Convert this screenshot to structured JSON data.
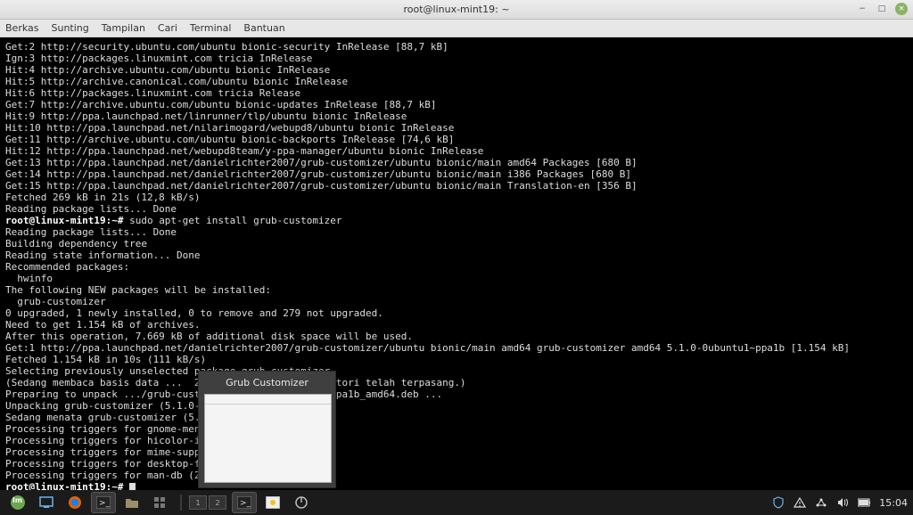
{
  "window": {
    "title": "root@linux-mint19: ~"
  },
  "menubar": {
    "items": [
      "Berkas",
      "Sunting",
      "Tampilan",
      "Cari",
      "Terminal",
      "Bantuan"
    ]
  },
  "terminal": {
    "lines": [
      "Get:2 http://security.ubuntu.com/ubuntu bionic-security InRelease [88,7 kB]",
      "Ign:3 http://packages.linuxmint.com tricia InRelease",
      "Hit:4 http://archive.ubuntu.com/ubuntu bionic InRelease",
      "Hit:5 http://archive.canonical.com/ubuntu bionic InRelease",
      "Hit:6 http://packages.linuxmint.com tricia Release",
      "Get:7 http://archive.ubuntu.com/ubuntu bionic-updates InRelease [88,7 kB]",
      "Hit:9 http://ppa.launchpad.net/linrunner/tlp/ubuntu bionic InRelease",
      "Hit:10 http://ppa.launchpad.net/nilarimogard/webupd8/ubuntu bionic InRelease",
      "Get:11 http://archive.ubuntu.com/ubuntu bionic-backports InRelease [74,6 kB]",
      "Hit:12 http://ppa.launchpad.net/webupd8team/y-ppa-manager/ubuntu bionic InRelease",
      "Get:13 http://ppa.launchpad.net/danielrichter2007/grub-customizer/ubuntu bionic/main amd64 Packages [680 B]",
      "Get:14 http://ppa.launchpad.net/danielrichter2007/grub-customizer/ubuntu bionic/main i386 Packages [680 B]",
      "Get:15 http://ppa.launchpad.net/danielrichter2007/grub-customizer/ubuntu bionic/main Translation-en [356 B]",
      "Fetched 269 kB in 21s (12,8 kB/s)",
      "Reading package lists... Done"
    ],
    "prompt1_user": "root@linux-mint19:~#",
    "prompt1_cmd": " sudo apt-get install grub-customizer",
    "lines2": [
      "Reading package lists... Done",
      "Building dependency tree",
      "Reading state information... Done",
      "Recommended packages:",
      "  hwinfo",
      "The following NEW packages will be installed:",
      "  grub-customizer",
      "0 upgraded, 1 newly installed, 0 to remove and 279 not upgraded.",
      "Need to get 1.154 kB of archives.",
      "After this operation, 7.669 kB of additional disk space will be used.",
      "Get:1 http://ppa.launchpad.net/danielrichter2007/grub-customizer/ubuntu bionic/main amd64 grub-customizer amd64 5.1.0-0ubuntu1~ppa1b [1.154 kB]",
      "Fetched 1.154 kB in 10s (111 kB/s)",
      "Selecting previously unselected package grub-customizer.",
      "(Sedang membaca basis data ...  249083 berkas atau direktori telah terpasang.)",
      "Preparing to unpack .../grub-customizer_5.1.0-0ubuntu1~ppa1b_amd64.deb ...",
      "Unpacking grub-customizer (5.1.0-0u",
      "Sedang menata grub-customizer (5.1.",
      "Processing triggers for gnome-menus",
      "Processing triggers for hicolor-ico",
      "Processing triggers for mime-suppor",
      "Processing triggers for desktop-fil",
      "Processing triggers for man-db (2.8"
    ],
    "prompt2_user": "root@linux-mint19:~#",
    "prompt2_cmd": " "
  },
  "preview": {
    "title": "Grub Customizer"
  },
  "panel": {
    "workspaces": [
      "1",
      "2"
    ],
    "clock": "15:04"
  },
  "icons": {
    "minimize": "−",
    "maximize": "□",
    "close": "×"
  }
}
